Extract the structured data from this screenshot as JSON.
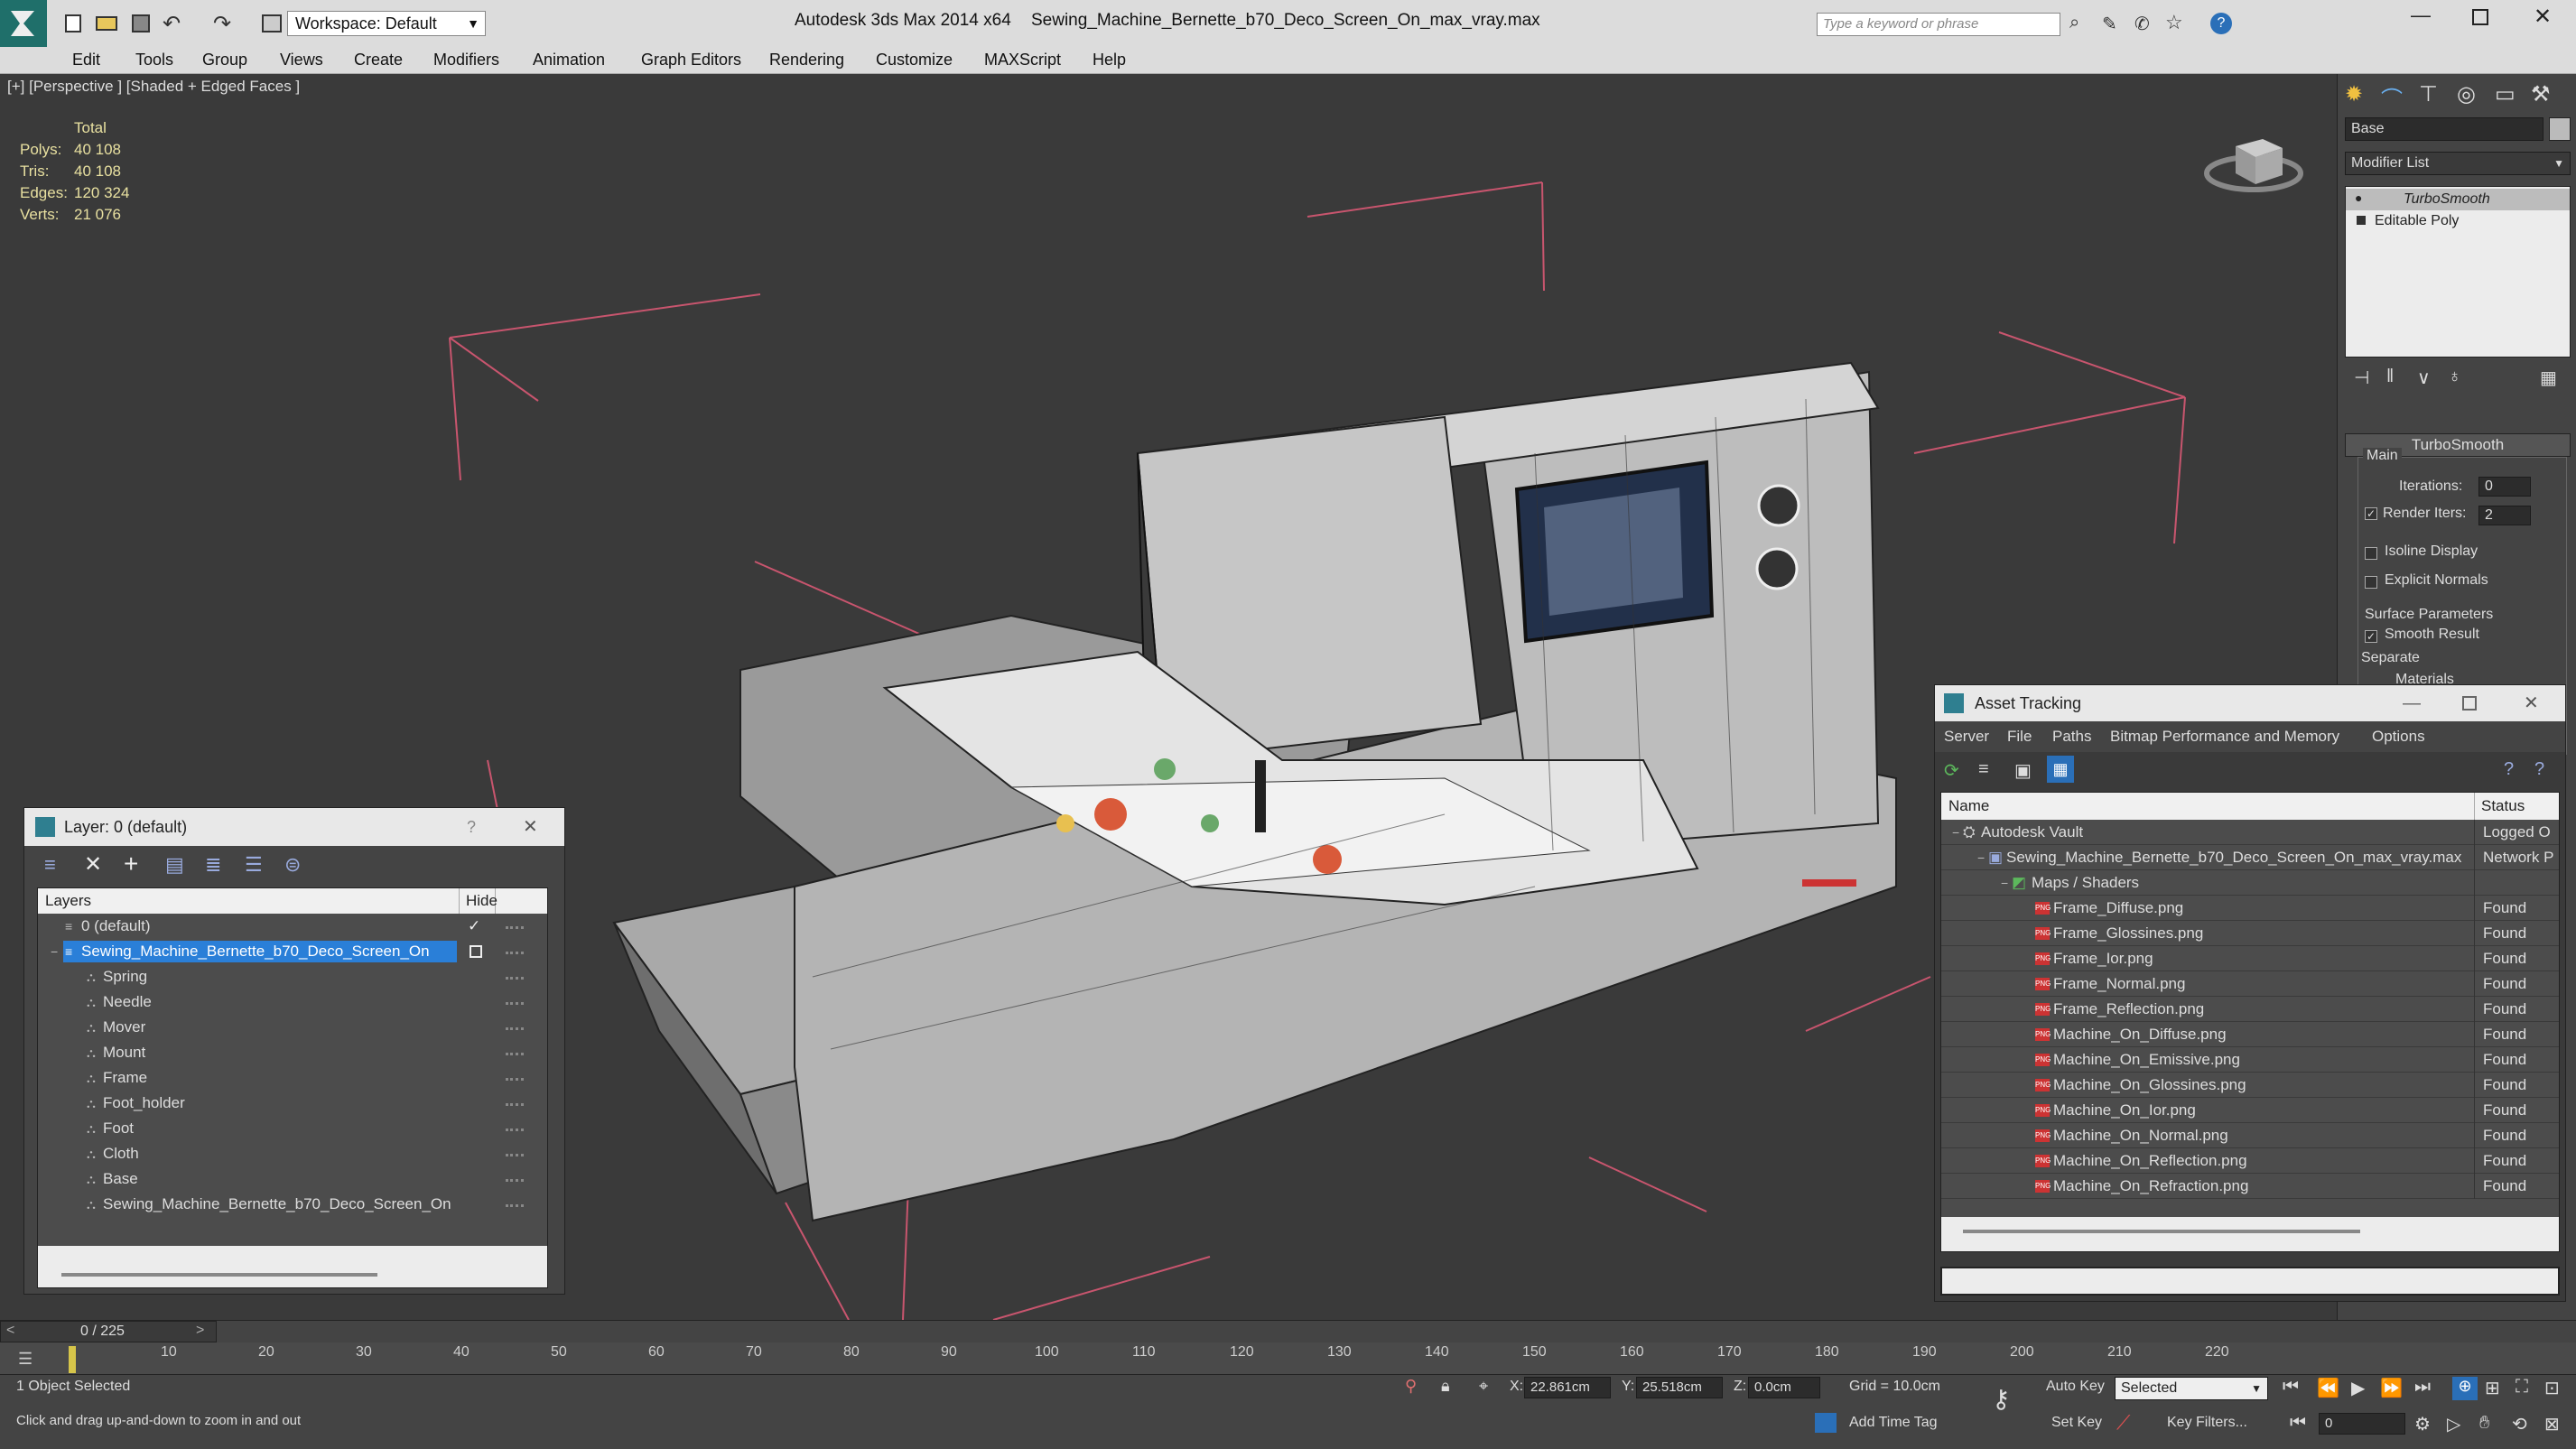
{
  "titlebar": {
    "app_title": "Autodesk 3ds Max  2014 x64",
    "file_name": "Sewing_Machine_Bernette_b70_Deco_Screen_On_max_vray.max",
    "workspace": "Workspace: Default",
    "search_placeholder": "Type a keyword or phrase"
  },
  "menu": [
    "Edit",
    "Tools",
    "Group",
    "Views",
    "Create",
    "Modifiers",
    "Animation",
    "Graph Editors",
    "Rendering",
    "Customize",
    "MAXScript",
    "Help"
  ],
  "viewport": {
    "label": "[+] [Perspective ] [Shaded + Edged Faces ]",
    "stats": {
      "header": "Total",
      "rows": [
        {
          "k": "Polys:",
          "v": "40 108"
        },
        {
          "k": "Tris:",
          "v": "40 108"
        },
        {
          "k": "Edges:",
          "v": "120 324"
        },
        {
          "k": "Verts:",
          "v": "21 076"
        }
      ]
    }
  },
  "cmdpanel": {
    "name_field": "Base",
    "modifier_list": "Modifier List",
    "stack": [
      "TurboSmooth",
      "Editable Poly"
    ],
    "rollout_title": "TurboSmooth",
    "main_label": "Main",
    "iterations_label": "Iterations:",
    "iterations_value": "0",
    "render_iters_label": "Render Iters:",
    "render_iters_value": "2",
    "isoline": "Isoline Display",
    "explicit_normals": "Explicit Normals",
    "surface_params": "Surface Parameters",
    "smooth_result": "Smooth Result",
    "separate": "Separate",
    "materials": "Materials"
  },
  "layer_dialog": {
    "title": "Layer: 0 (default)",
    "help": "?",
    "col_layers": "Layers",
    "col_hide": "Hide",
    "rows": [
      {
        "label": "0 (default)",
        "indent": 1
      },
      {
        "label": "Sewing_Machine_Bernette_b70_Deco_Screen_On",
        "indent": 1,
        "selected": true
      },
      {
        "label": "Spring",
        "indent": 2
      },
      {
        "label": "Needle",
        "indent": 2
      },
      {
        "label": "Mover",
        "indent": 2
      },
      {
        "label": "Mount",
        "indent": 2
      },
      {
        "label": "Frame",
        "indent": 2
      },
      {
        "label": "Foot_holder",
        "indent": 2
      },
      {
        "label": "Foot",
        "indent": 2
      },
      {
        "label": "Cloth",
        "indent": 2
      },
      {
        "label": "Base",
        "indent": 2
      },
      {
        "label": "Sewing_Machine_Bernette_b70_Deco_Screen_On",
        "indent": 2
      }
    ]
  },
  "asset_dialog": {
    "title": "Asset Tracking",
    "menu": [
      "Server",
      "File",
      "Paths",
      "Bitmap Performance and Memory",
      "Options"
    ],
    "col_name": "Name",
    "col_status": "Status",
    "rows": [
      {
        "name": "Autodesk Vault",
        "status": "Logged O",
        "level": 0
      },
      {
        "name": "Sewing_Machine_Bernette_b70_Deco_Screen_On_max_vray.max",
        "status": "Network P",
        "level": 1
      },
      {
        "name": "Maps / Shaders",
        "status": "",
        "level": 2
      },
      {
        "name": "Frame_Diffuse.png",
        "status": "Found",
        "level": 3
      },
      {
        "name": "Frame_Glossines.png",
        "status": "Found",
        "level": 3
      },
      {
        "name": "Frame_Ior.png",
        "status": "Found",
        "level": 3
      },
      {
        "name": "Frame_Normal.png",
        "status": "Found",
        "level": 3
      },
      {
        "name": "Frame_Reflection.png",
        "status": "Found",
        "level": 3
      },
      {
        "name": "Machine_On_Diffuse.png",
        "status": "Found",
        "level": 3
      },
      {
        "name": "Machine_On_Emissive.png",
        "status": "Found",
        "level": 3
      },
      {
        "name": "Machine_On_Glossines.png",
        "status": "Found",
        "level": 3
      },
      {
        "name": "Machine_On_Ior.png",
        "status": "Found",
        "level": 3
      },
      {
        "name": "Machine_On_Normal.png",
        "status": "Found",
        "level": 3
      },
      {
        "name": "Machine_On_Reflection.png",
        "status": "Found",
        "level": 3
      },
      {
        "name": "Machine_On_Refraction.png",
        "status": "Found",
        "level": 3
      }
    ]
  },
  "timeline": {
    "frame": "0 / 225",
    "ticks": [
      "10",
      "20",
      "30",
      "40",
      "50",
      "60",
      "70",
      "80",
      "90",
      "100",
      "110",
      "120",
      "130",
      "140",
      "150",
      "160",
      "170",
      "180",
      "190",
      "200",
      "210",
      "220"
    ]
  },
  "status": {
    "selected": "1 Object Selected",
    "hint": "Click and drag up-and-down to zoom in and out",
    "x_label": "X:",
    "x_value": "22.861cm",
    "y_label": "Y:",
    "y_value": "25.518cm",
    "z_label": "Z:",
    "z_value": "0.0cm",
    "grid": "Grid = 10.0cm",
    "auto_key": "Auto Key",
    "set_key": "Set Key",
    "selected_dd": "Selected",
    "key_filters": "Key Filters...",
    "add_time_tag": "Add Time Tag",
    "frame_field": "0"
  }
}
